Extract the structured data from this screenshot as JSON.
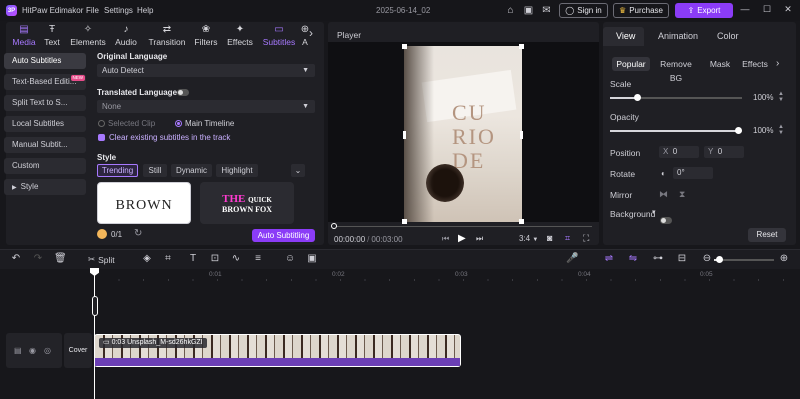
{
  "titlebar": {
    "app_name": "HitPaw Edimakor",
    "menu": [
      "File",
      "Settings",
      "Help"
    ],
    "project_name": "2025-06-14_02",
    "signin_label": "Sign in",
    "purchase_label": "Purchase",
    "export_label": "Export",
    "window_controls": [
      "minimize-icon",
      "maximize-icon",
      "close-icon"
    ]
  },
  "categories": [
    {
      "label": "Media",
      "icon": "media-icon",
      "active": true
    },
    {
      "label": "Text",
      "icon": "text-icon",
      "active": false
    },
    {
      "label": "Elements",
      "icon": "elements-icon",
      "active": false
    },
    {
      "label": "Audio",
      "icon": "audio-icon",
      "active": false
    },
    {
      "label": "Transition",
      "icon": "transition-icon",
      "active": false
    },
    {
      "label": "Filters",
      "icon": "filters-icon",
      "active": false
    },
    {
      "label": "Effects",
      "icon": "effects-icon",
      "active": false
    },
    {
      "label": "Subtitles",
      "icon": "subtitles-icon",
      "active": true
    },
    {
      "label": "A",
      "icon": "more-icon",
      "active": false
    }
  ],
  "subtitle_menu": [
    {
      "label": "Auto Subtitles",
      "active": true
    },
    {
      "label": "Text-Based Editi...",
      "badge": "NEW"
    },
    {
      "label": "Split Text to S..."
    },
    {
      "label": "Local Subtitles"
    },
    {
      "label": "Manual Subtit..."
    },
    {
      "label": "Custom"
    },
    {
      "label": "Style"
    }
  ],
  "subtitle_form": {
    "original_language_label": "Original Language",
    "original_language_value": "Auto Detect",
    "translated_language_label": "Translated Language",
    "translated_language_value": "None",
    "scope_selected_clip": "Selected Clip",
    "scope_main_timeline": "Main Timeline",
    "clear_existing_label": "Clear existing subtitles in the track",
    "style_label": "Style",
    "style_tabs": [
      "Trending",
      "Still",
      "Dynamic",
      "Highlight"
    ],
    "style_card1_text": "BROWN",
    "style_card2_line1_a": "THE",
    "style_card2_line1_b": "QUICK",
    "style_card2_line2": "BROWN FOX",
    "credits": "0/1",
    "auto_subtitling_label": "Auto Subtitling"
  },
  "player": {
    "title": "Player",
    "time_current": "00:00:00",
    "time_total": "00:03:00",
    "aspect_ratio": "3:4",
    "video_text": "CU RIO DE"
  },
  "properties": {
    "tabs": [
      "View",
      "Animation",
      "Color"
    ],
    "subtabs": [
      "Popular",
      "Remove BG",
      "Mask",
      "Effects"
    ],
    "scale_label": "Scale",
    "scale_value": "100%",
    "opacity_label": "Opacity",
    "opacity_value": "100%",
    "position_label": "Position",
    "pos_x_label": "X",
    "pos_x_value": "0",
    "pos_y_label": "Y",
    "pos_y_value": "0",
    "rotate_label": "Rotate",
    "rotate_value": "0°",
    "mirror_label": "Mirror",
    "background_label": "Background",
    "reset_label": "Reset"
  },
  "timeline": {
    "split_label": "Split",
    "ruler_ticks": [
      "0:01",
      "0:02",
      "0:03",
      "0:04",
      "0:05"
    ],
    "cover_label": "Cover",
    "clip_label": "0:03 Unsplash_M-sd26hkGZI"
  },
  "colors": {
    "accent": "#8b3cf7",
    "accent_light": "#a779ff"
  }
}
